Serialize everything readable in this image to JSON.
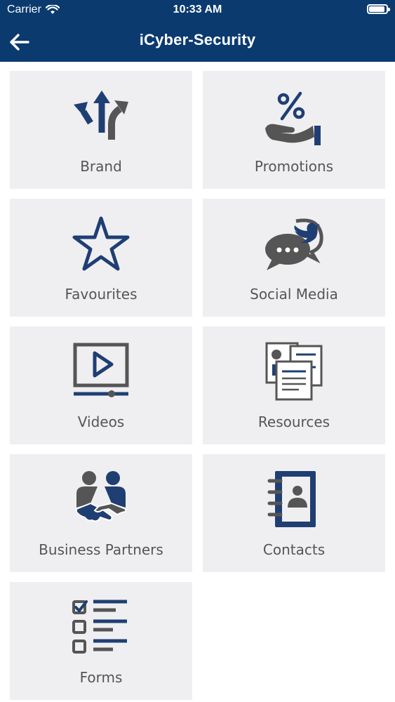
{
  "status_bar": {
    "carrier": "Carrier",
    "time": "10:33 AM"
  },
  "header": {
    "title": "iCyber-Security",
    "back_icon": "arrow-left-icon"
  },
  "colors": {
    "navy": "#0b3a6f",
    "tile_bg": "#efeff1",
    "icon_gray": "#555555",
    "icon_blue": "#1f3f73"
  },
  "tiles": [
    {
      "label": "Brand",
      "icon": "split-arrows-icon"
    },
    {
      "label": "Promotions",
      "icon": "percent-hand-icon"
    },
    {
      "label": "Favourites",
      "icon": "star-icon"
    },
    {
      "label": "Social Media",
      "icon": "twitter-chat-icon"
    },
    {
      "label": "Videos",
      "icon": "video-player-icon"
    },
    {
      "label": "Resources",
      "icon": "documents-icon"
    },
    {
      "label": "Business Partners",
      "icon": "handshake-icon"
    },
    {
      "label": "Contacts",
      "icon": "address-book-icon"
    },
    {
      "label": "Forms",
      "icon": "checklist-icon"
    }
  ]
}
